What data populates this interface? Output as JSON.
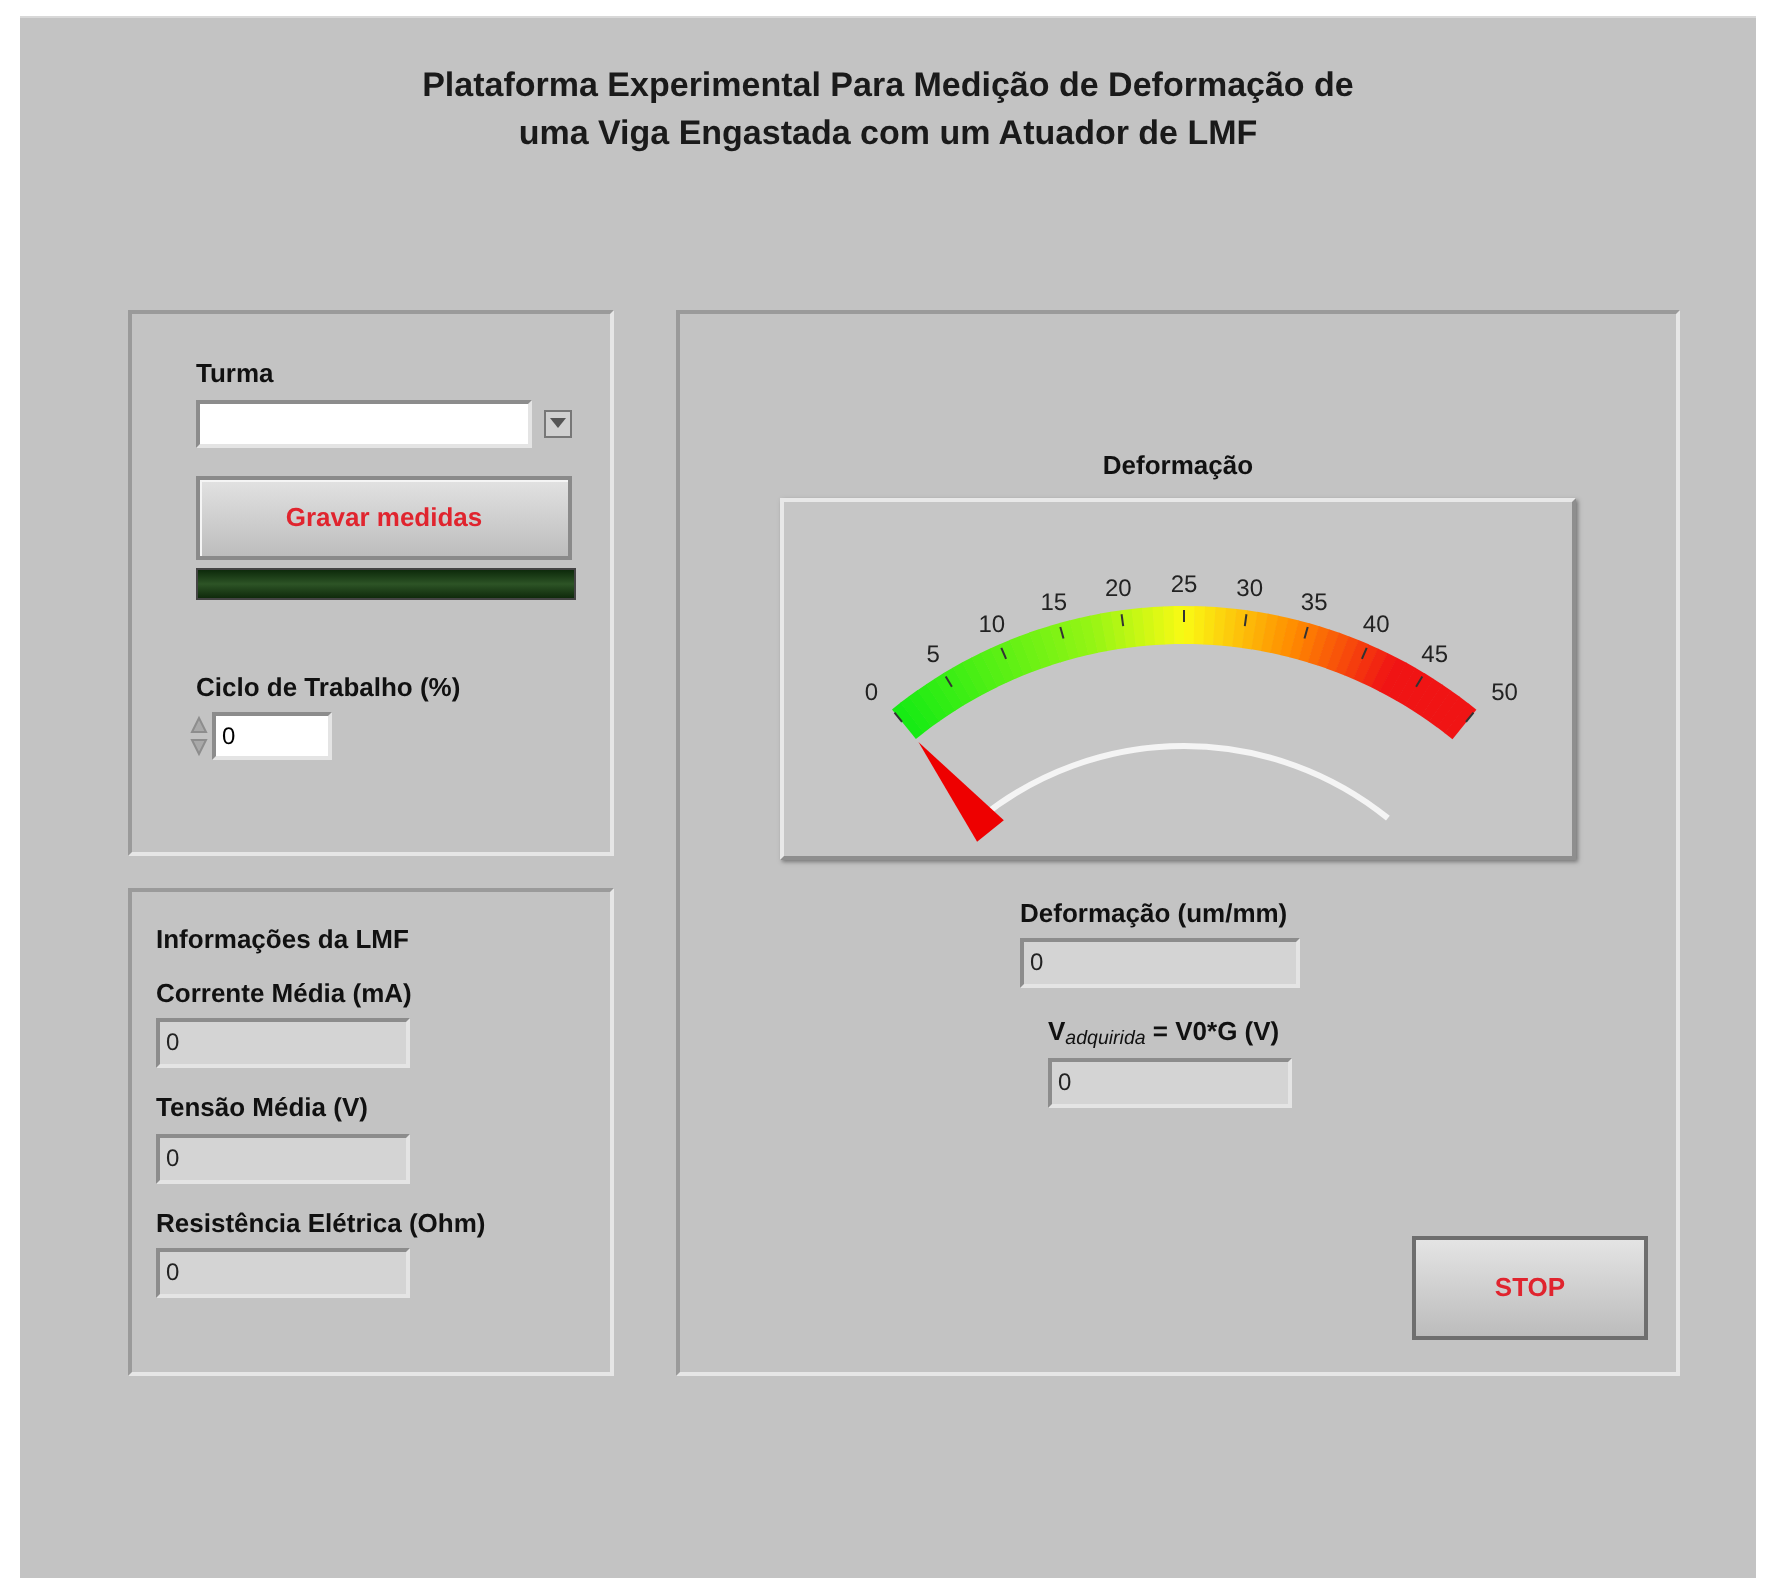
{
  "title_lines": [
    "Plataforma Experimental Para Medição de Deformação de",
    "uma Viga Engastada com um Atuador de LMF"
  ],
  "controls_panel": {
    "turma": {
      "label": "Turma"
    },
    "record_button": {
      "label": "Gravar medidas"
    },
    "record_led": {
      "on": false
    },
    "duty_cycle": {
      "label": "Ciclo de Trabalho (%)",
      "value": "0"
    }
  },
  "info_panel": {
    "title": "Informações da LMF",
    "fields": [
      {
        "label": "Corrente Média (mA)",
        "value": "0"
      },
      {
        "label": "Tensão Média (V)",
        "value": "0"
      },
      {
        "label": "Resistência Elétrica (Ohm)",
        "value": "0"
      }
    ]
  },
  "gauge": {
    "title": "Deformação",
    "level": 0,
    "scale_labels": [
      "0",
      "5",
      "10",
      "15",
      "20",
      "25",
      "30",
      "35",
      "40",
      "45",
      "50"
    ]
  },
  "outputs": [
    {
      "label": "Deformação (um/mm)",
      "value": "0"
    },
    {
      "label": "V$_{adquirida}$ = V0*G (V)",
      "value": "0"
    }
  ],
  "stop_button": {
    "label": "STOP"
  }
}
